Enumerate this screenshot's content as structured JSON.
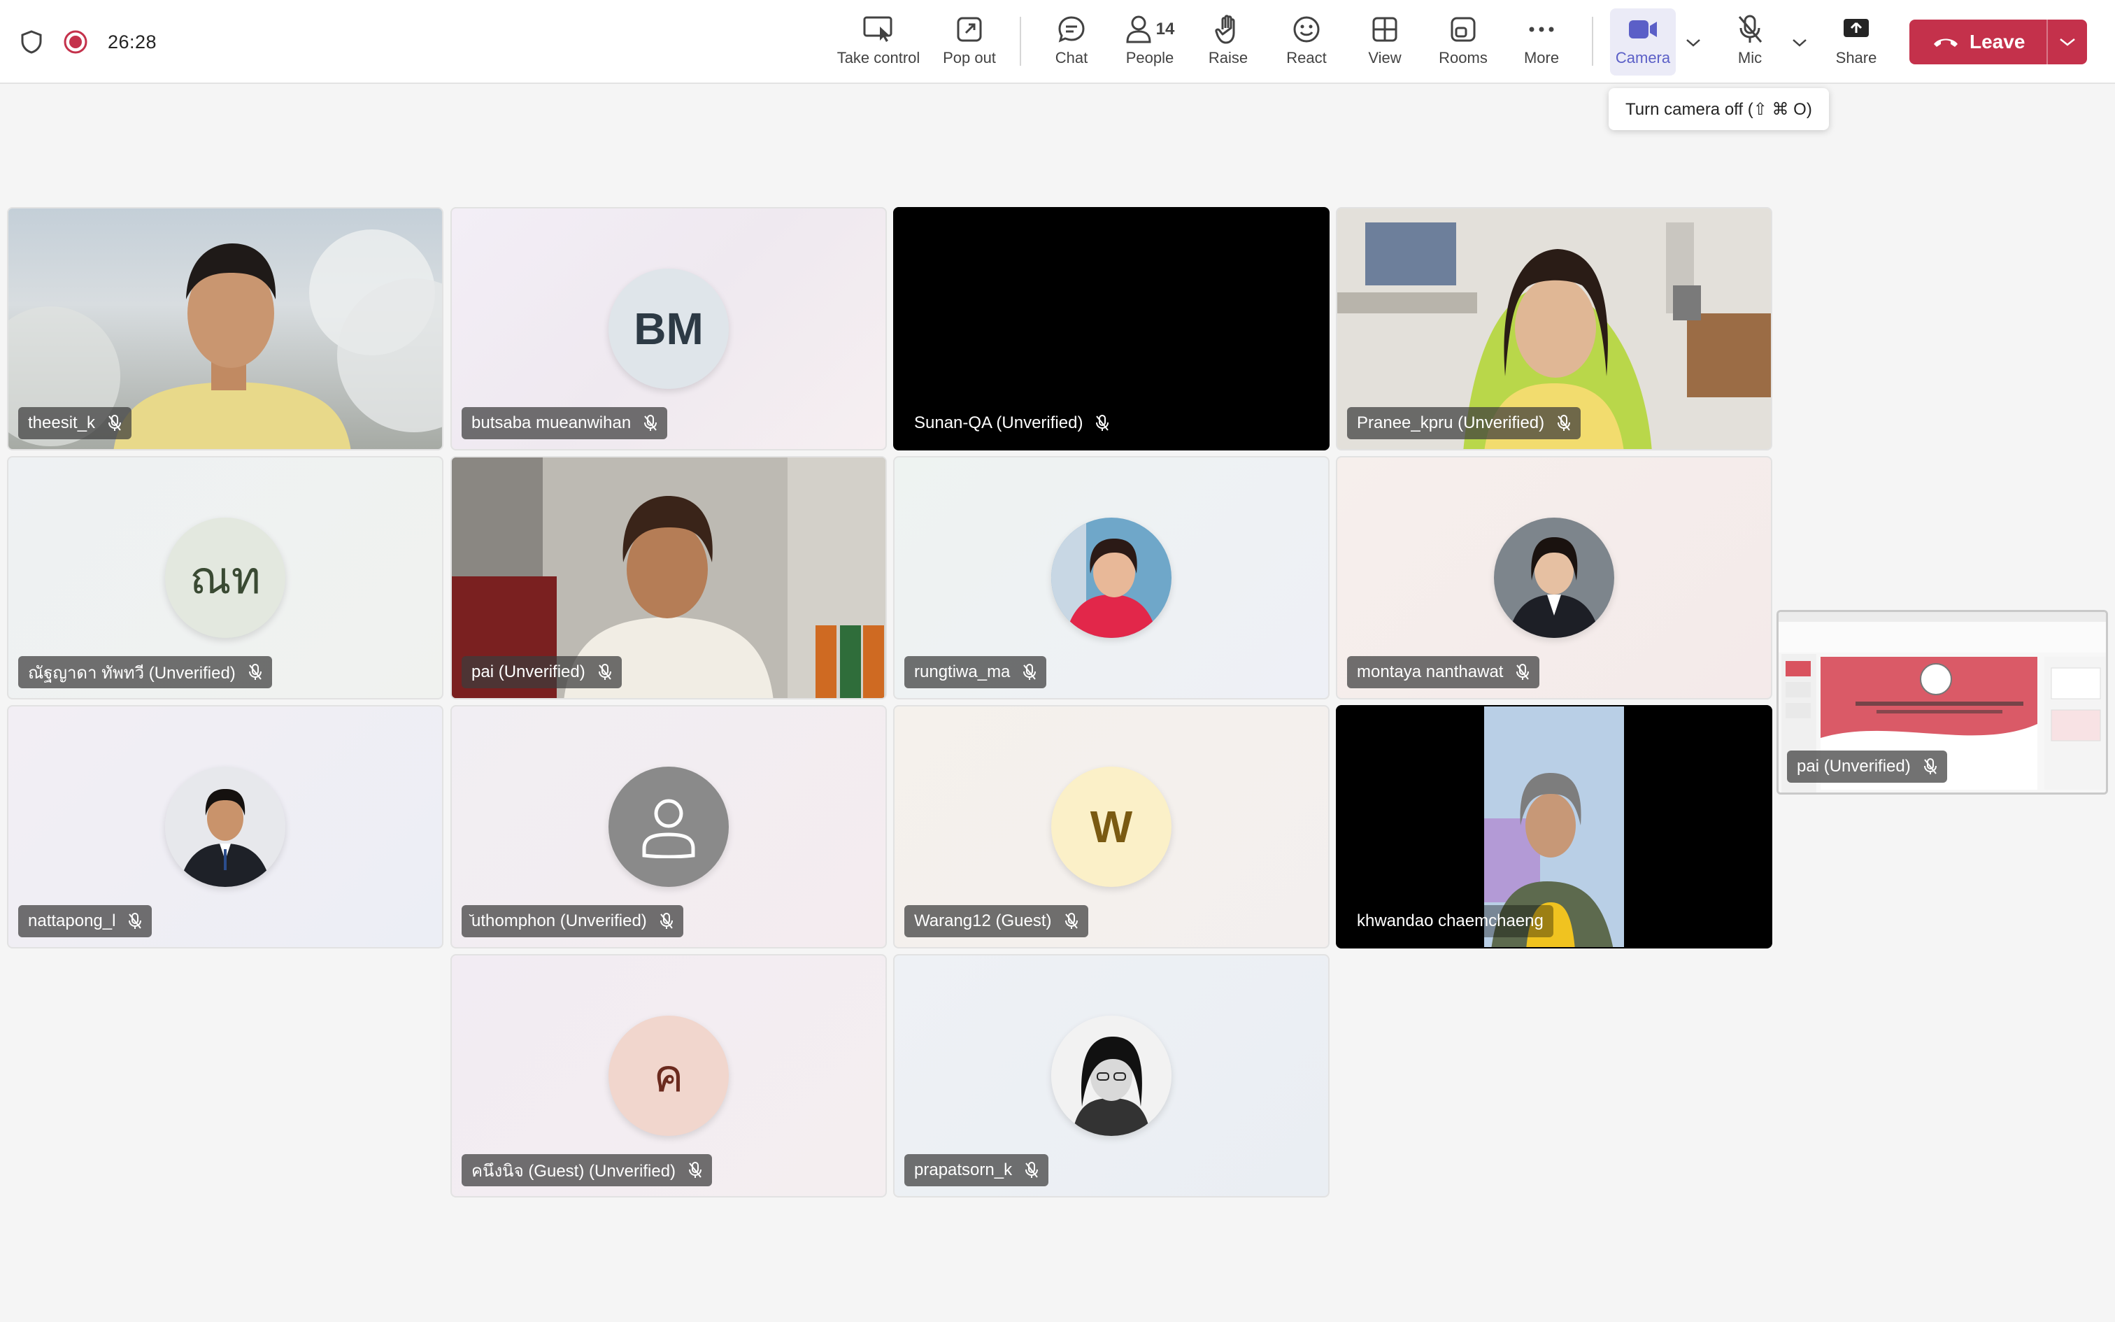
{
  "topbar": {
    "timer": "26:28",
    "buttons": {
      "take_control": "Take control",
      "pop_out": "Pop out",
      "chat": "Chat",
      "people": "People",
      "people_count": "14",
      "raise": "Raise",
      "react": "React",
      "view": "View",
      "rooms": "Rooms",
      "more": "More",
      "camera": "Camera",
      "mic": "Mic",
      "share": "Share",
      "leave": "Leave"
    },
    "tooltip": "Turn camera off (⇧ ⌘ O)",
    "colors": {
      "accent": "#5b5fc7",
      "leave": "#c4314b",
      "recording": "#c4314b"
    }
  },
  "participants": [
    {
      "name": "theesit_k",
      "kind": "video"
    },
    {
      "name": "butsaba mueanwihan",
      "kind": "initials",
      "initials": "BM"
    },
    {
      "name": "Sunan-QA (Unverified)",
      "kind": "dark"
    },
    {
      "name": "Pranee_kpru (Unverified)",
      "kind": "video"
    },
    {
      "name": "ณัฐญาดา ทัพทวี (Unverified)",
      "kind": "initials",
      "initials": "ณท"
    },
    {
      "name": "pai (Unverified)",
      "kind": "video"
    },
    {
      "name": "rungtiwa_ma",
      "kind": "photo"
    },
    {
      "name": "montaya nanthawat",
      "kind": "photo"
    },
    {
      "name": "nattapong_l",
      "kind": "photo"
    },
    {
      "name": "̆uthomphon (Unverified)",
      "kind": "generic"
    },
    {
      "name": "Warang12 (Guest)",
      "kind": "initials",
      "initials": "W"
    },
    {
      "name": "khwandao chaemchaeng",
      "kind": "video"
    },
    {
      "name": "คนึงนิจ (Guest) (Unverified)",
      "kind": "initials",
      "initials": "ค"
    },
    {
      "name": "prapatsorn_k",
      "kind": "photo"
    }
  ],
  "pip": {
    "name": "pai (Unverified)"
  }
}
